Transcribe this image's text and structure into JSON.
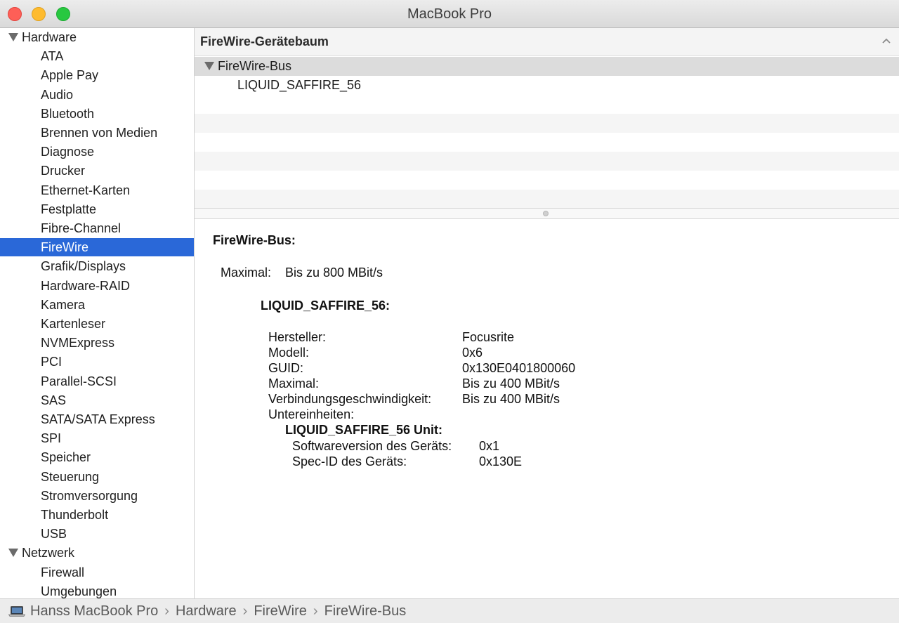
{
  "window": {
    "title": "MacBook Pro"
  },
  "sidebar": {
    "groups": [
      {
        "label": "Hardware",
        "items": [
          "ATA",
          "Apple Pay",
          "Audio",
          "Bluetooth",
          "Brennen von Medien",
          "Diagnose",
          "Drucker",
          "Ethernet-Karten",
          "Festplatte",
          "Fibre-Channel",
          "FireWire",
          "Grafik/Displays",
          "Hardware-RAID",
          "Kamera",
          "Kartenleser",
          "NVMExpress",
          "PCI",
          "Parallel-SCSI",
          "SAS",
          "SATA/SATA Express",
          "SPI",
          "Speicher",
          "Steuerung",
          "Stromversorgung",
          "Thunderbolt",
          "USB"
        ]
      },
      {
        "label": "Netzwerk",
        "items": [
          "Firewall",
          "Umgebungen"
        ]
      }
    ],
    "selected": "FireWire"
  },
  "tree": {
    "header": "FireWire-Gerätebaum",
    "bus": "FireWire-Bus",
    "device": "LIQUID_SAFFIRE_56"
  },
  "detail": {
    "bus_title": "FireWire-Bus:",
    "max_label": "Maximal:",
    "max_value": "Bis zu 800 MBit/s",
    "device_title": "LIQUID_SAFFIRE_56:",
    "props": [
      {
        "label": "Hersteller:",
        "value": "Focusrite"
      },
      {
        "label": "Modell:",
        "value": "0x6"
      },
      {
        "label": "GUID:",
        "value": "0x130E0401800060"
      },
      {
        "label": "Maximal:",
        "value": "Bis zu 400 MBit/s"
      },
      {
        "label": "Verbindungsgeschwindigkeit:",
        "value": "Bis zu 400 MBit/s"
      }
    ],
    "subunits_label": "Untereinheiten:",
    "unit_title": "LIQUID_SAFFIRE_56 Unit:",
    "unit_props": [
      {
        "label": "Softwareversion des Geräts:",
        "value": "0x1"
      },
      {
        "label": "Spec-ID des Geräts:",
        "value": "0x130E"
      }
    ]
  },
  "pathbar": {
    "crumbs": [
      "Hanss MacBook Pro",
      "Hardware",
      "FireWire",
      "FireWire-Bus"
    ]
  },
  "colors": {
    "selection": "#2a68d8",
    "close": "#fe5f57",
    "minimize": "#febb2e",
    "zoom": "#28c840"
  }
}
